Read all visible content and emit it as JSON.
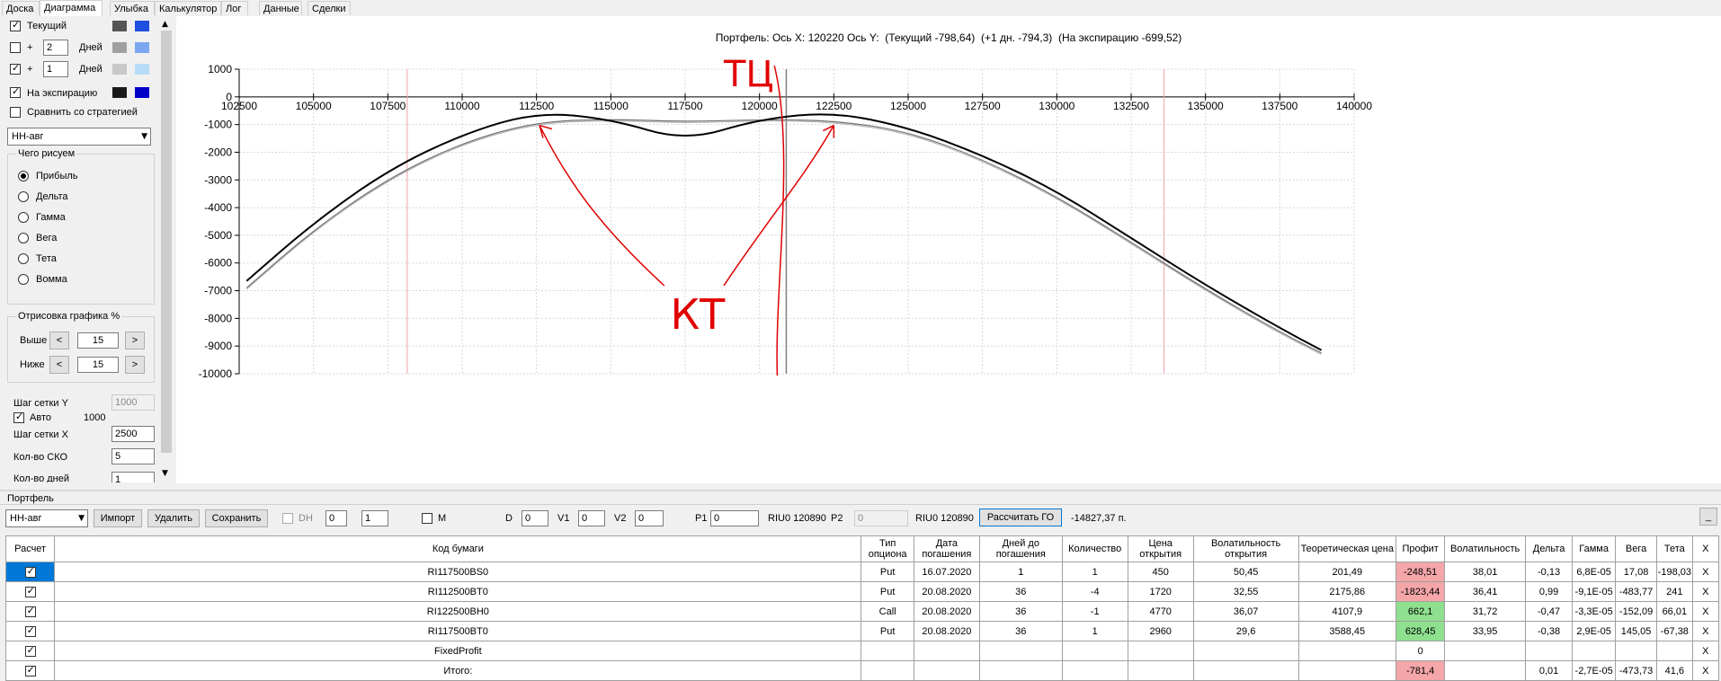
{
  "tabs": [
    "Доска",
    "Диаграмма",
    "Улыбка",
    "Калькулятор",
    "Лог",
    "Данные",
    "Сделки"
  ],
  "active_tab": "Диаграмма",
  "left_panel": {
    "current_label": "Текущий",
    "plus1_label": "+",
    "plus1_value": "2",
    "plus1_unit": "Дней",
    "plus2_label": "+",
    "plus2_value": "1",
    "plus2_unit": "Дней",
    "expiry_label": "На экспирацию",
    "compare_label": "Сравнить со стратегией",
    "strategy_select": "НН-авг",
    "what_group_title": "Чего рисуем",
    "radio_options": [
      "Прибыль",
      "Дельта",
      "Гамма",
      "Вега",
      "Тета",
      "Вомма"
    ],
    "radio_selected": "Прибыль",
    "draw_group_title": "Отрисовка графика %",
    "above_label": "Выше",
    "above_value": "15",
    "below_label": "Ниже",
    "below_value": "15",
    "btn_prev": "<",
    "btn_next": ">",
    "grid_y_label": "Шаг сетки Y",
    "grid_y_value": "1000",
    "auto_label": "Авто",
    "auto_value": "1000",
    "grid_x_label": "Шаг сетки X",
    "grid_x_value": "2500",
    "sko_label": "Кол-во СКО",
    "sko_value": "5",
    "days_label": "Кол-во дней",
    "days_value": "1",
    "colors": {
      "current_a": "#555555",
      "current_b": "#1f4fe0",
      "plus1_a": "#a0a0a0",
      "plus1_b": "#7aa7f0",
      "plus2_a": "#c8c8c8",
      "plus2_b": "#b6dcf8",
      "expiry_a": "#1a1a1a",
      "expiry_b": "#0000c8"
    }
  },
  "chart_header": {
    "title": "Портфель: Ось X:",
    "x_value": "120220",
    "y_label": "Ось Y:",
    "current": "(Текущий -798,64)",
    "plus_day": "(+1 дн. -794,3)",
    "expiry": "(На экспирацию -699,52)"
  },
  "chart_data": {
    "type": "line",
    "xlim": [
      102500,
      140000
    ],
    "ylim": [
      -10000,
      1000
    ],
    "x_ticks": [
      102500,
      105000,
      107500,
      110000,
      112500,
      115000,
      117500,
      120000,
      122500,
      125000,
      127500,
      130000,
      132500,
      135000,
      137500,
      140000
    ],
    "y_ticks": [
      1000,
      0,
      -1000,
      -2000,
      -3000,
      -4000,
      -5000,
      -6000,
      -7000,
      -8000,
      -9000,
      -10000
    ],
    "grid": true,
    "series": [
      {
        "name": "На экспирацию",
        "color": "#000000",
        "x": [
          102750,
          105000,
          107500,
          110000,
          112500,
          115000,
          117500,
          120000,
          122500,
          125000,
          127500,
          130000,
          132500,
          135000,
          137500,
          138900
        ],
        "y": [
          -6650,
          -4550,
          -2650,
          -1350,
          -550,
          -800,
          -1600,
          -800,
          -550,
          -1100,
          -2100,
          -3400,
          -5100,
          -6800,
          -8350,
          -9150
        ]
      },
      {
        "name": "Текущий",
        "color": "#707070",
        "x": [
          102750,
          105000,
          107500,
          110000,
          112500,
          115000,
          117500,
          120000,
          122500,
          125000,
          127500,
          130000,
          132500,
          135000,
          137500,
          138900
        ],
        "y": [
          -6900,
          -4800,
          -2950,
          -1650,
          -900,
          -800,
          -900,
          -820,
          -850,
          -1250,
          -2250,
          -3600,
          -5250,
          -6950,
          -8500,
          -9250
        ]
      },
      {
        "name": "+1 дн.",
        "color": "#b0b0b0",
        "x": [
          102750,
          105000,
          107500,
          110000,
          112500,
          115000,
          117500,
          120000,
          122500,
          125000,
          127500,
          130000,
          132500,
          135000,
          137500,
          138900
        ],
        "y": [
          -6950,
          -4850,
          -3000,
          -1700,
          -950,
          -850,
          -950,
          -860,
          -900,
          -1300,
          -2300,
          -3650,
          -5300,
          -7000,
          -8550,
          -9300
        ]
      }
    ],
    "vertical_markers": {
      "cursor_x": 120900,
      "sd_lines": [
        108150,
        133600
      ]
    },
    "annotations": [
      "ТЦ",
      "КТ"
    ]
  },
  "portfolio": {
    "section_title": "Портфель",
    "strategy_select": "НН-авг",
    "import_btn": "Импорт",
    "delete_btn": "Удалить",
    "save_btn": "Сохранить",
    "dh_label": "DH",
    "spin1": "0",
    "spin2": "1",
    "m_label": "M",
    "d_label": "D",
    "d_value": "0",
    "v1_label": "V1",
    "v1_value": "0",
    "v2_label": "V2",
    "v2_value": "0",
    "p1_label": "P1",
    "p1_value": "0",
    "riu1": "RIU0 120890",
    "p2_label": "P2",
    "p2_value": "0",
    "riu2": "RIU0 120890",
    "calc_btn": "Рассчитать ГО",
    "go_value": "-14827,37 п.",
    "min_btn": "_"
  },
  "table": {
    "headers": [
      "Расчет",
      "Код бумаги",
      "Тип опциона",
      "Дата погашения",
      "Дней до погашения",
      "Количество",
      "Цена открытия",
      "Волатильность открытия",
      "Теоретическая цена",
      "Профит",
      "Волатильность",
      "Дельта",
      "Гамма",
      "Вега",
      "Тета",
      "X"
    ],
    "rows": [
      {
        "code": "RI117500BS0",
        "type": "Put",
        "date": "16.07.2020",
        "days": "1",
        "qty": "1",
        "price": "450",
        "vol_open": "50,45",
        "theo": "201,49",
        "profit": "-248,51",
        "profit_sign": "neg",
        "vol": "38,01",
        "delta": "-0,13",
        "gamma": "6,8E-05",
        "vega": "17,08",
        "theta": "-198,03",
        "x": "X"
      },
      {
        "code": "RI112500BT0",
        "type": "Put",
        "date": "20.08.2020",
        "days": "36",
        "qty": "-4",
        "price": "1720",
        "vol_open": "32,55",
        "theo": "2175,86",
        "profit": "-1823,44",
        "profit_sign": "neg",
        "vol": "36,41",
        "delta": "0,99",
        "gamma": "-9,1E-05",
        "vega": "-483,77",
        "theta": "241",
        "x": "X"
      },
      {
        "code": "RI122500BH0",
        "type": "Call",
        "date": "20.08.2020",
        "days": "36",
        "qty": "-1",
        "price": "4770",
        "vol_open": "36,07",
        "theo": "4107,9",
        "profit": "662,1",
        "profit_sign": "pos",
        "vol": "31,72",
        "delta": "-0,47",
        "gamma": "-3,3E-05",
        "vega": "-152,09",
        "theta": "66,01",
        "x": "X"
      },
      {
        "code": "RI117500BT0",
        "type": "Put",
        "date": "20.08.2020",
        "days": "36",
        "qty": "1",
        "price": "2960",
        "vol_open": "29,6",
        "theo": "3588,45",
        "profit": "628,45",
        "profit_sign": "pos",
        "vol": "33,95",
        "delta": "-0,38",
        "gamma": "2,9E-05",
        "vega": "145,05",
        "theta": "-67,38",
        "x": "X"
      },
      {
        "code": "FixedProfit",
        "type": "",
        "date": "",
        "days": "",
        "qty": "",
        "price": "",
        "vol_open": "",
        "theo": "",
        "profit": "0",
        "profit_sign": "",
        "vol": "",
        "delta": "",
        "gamma": "",
        "vega": "",
        "theta": "",
        "x": "X"
      },
      {
        "code": "Итого:",
        "type": "",
        "date": "",
        "days": "",
        "qty": "",
        "price": "",
        "vol_open": "",
        "theo": "",
        "profit": "-781,4",
        "profit_sign": "neg",
        "vol": "",
        "delta": "0,01",
        "gamma": "-2,7E-05",
        "vega": "-473,73",
        "theta": "41,6",
        "x": "X"
      }
    ]
  }
}
